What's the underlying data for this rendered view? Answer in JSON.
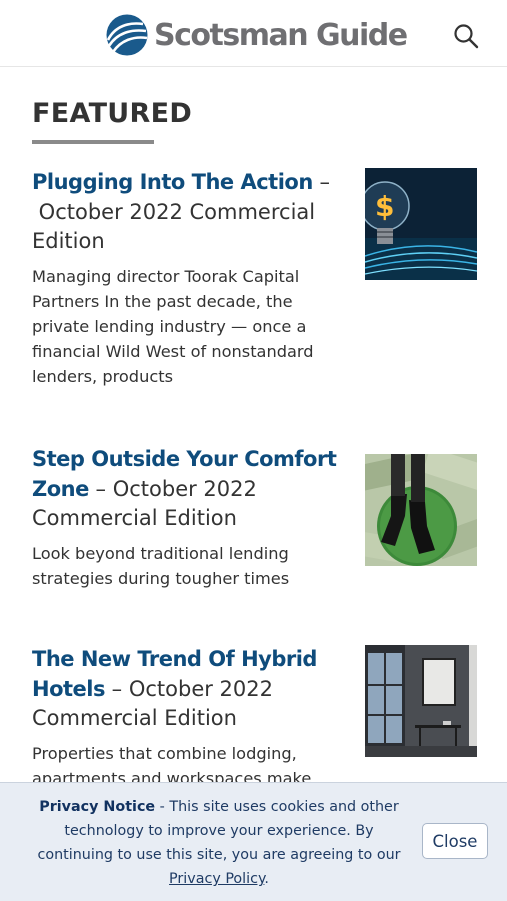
{
  "header": {
    "logo_text": "Scotsman Guide",
    "search_icon": "search-icon"
  },
  "featured": {
    "heading": "FEATURED",
    "articles": [
      {
        "title": "Plugging Into The Action",
        "separator": " – ",
        "edition": " October 2022 Commercial Edition",
        "excerpt": "Managing director Toorak Capital Partners In the past decade, the private lending industry — once a financial Wild West of nonstandard lenders, products",
        "image": "lightbulb-dollar-image"
      },
      {
        "title": "Step Outside Your Comfort Zone",
        "separator": " – ",
        "edition": "October 2022 Commercial Edition",
        "excerpt": "Look beyond traditional lending strategies during tougher times",
        "image": "shoes-on-money-image"
      },
      {
        "title": "The New Trend Of Hybrid Hotels",
        "separator": " – ",
        "edition": "October 2022 Commercial Edition",
        "excerpt": "Properties that combine lodging, apartments and workspaces make",
        "image": "hybrid-room-image"
      }
    ]
  },
  "privacy": {
    "label": "Privacy Notice",
    "text": " - This site uses cookies and other technology to improve your experience. By continuing to use this site, you are agreeing to our ",
    "link": "Privacy Policy",
    "end": ".",
    "close_label": "Close"
  },
  "colors": {
    "link_blue": "#0f4c7c",
    "logo_gray": "#6f6f72",
    "notice_bg": "#e8edf4"
  }
}
